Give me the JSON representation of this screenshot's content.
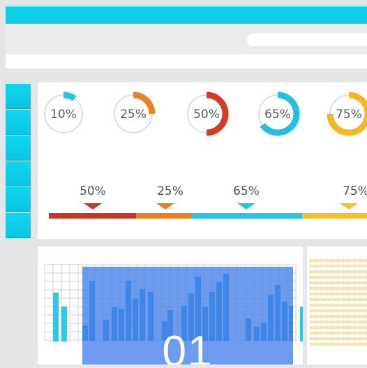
{
  "progress_rings": [
    {
      "label": "10%",
      "value": 10,
      "color": "#2fc2e0"
    },
    {
      "label": "25%",
      "value": 25,
      "color": "#ea8322"
    },
    {
      "label": "50%",
      "value": 50,
      "color": "#d53a25"
    },
    {
      "label": "65%",
      "value": 65,
      "color": "#25bfe3"
    },
    {
      "label": "75%",
      "value": 75,
      "color": "#f4b726"
    }
  ],
  "milestones": [
    {
      "label": "50%",
      "color": "#c0392b"
    },
    {
      "label": "25%",
      "color": "#e67e22"
    },
    {
      "label": "65%",
      "color": "#2fc2e0"
    },
    {
      "label": "75%",
      "color": "#f2c12e"
    }
  ],
  "overlay": {
    "number": "01"
  },
  "colors": {
    "accent": "#0ad3ec",
    "overlay": "#528aec",
    "bars": "#2fc6e8"
  }
}
